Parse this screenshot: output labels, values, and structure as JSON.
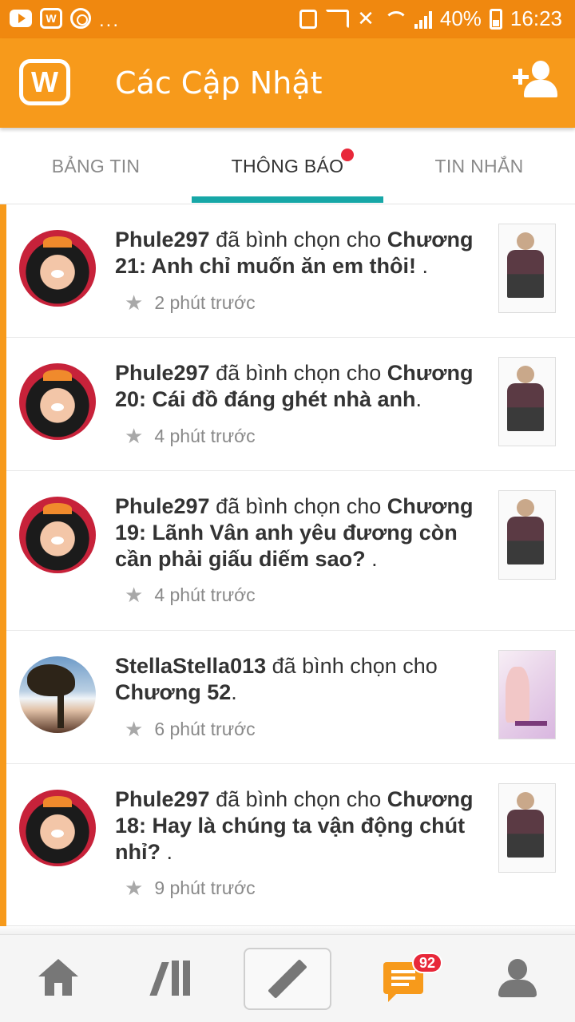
{
  "status_bar": {
    "ellipsis": "...",
    "battery": "40%",
    "time": "16:23",
    "icons": [
      "youtube-icon",
      "wattpad-icon",
      "sync-icon",
      "battery-saver-icon",
      "cast-icon",
      "mute-icon",
      "wifi-icon",
      "signal-icon",
      "battery-icon"
    ]
  },
  "app_bar": {
    "logo_letter": "W",
    "title": "Các Cập Nhật",
    "action_icon": "add-user-icon",
    "color": "#f79a1b"
  },
  "tabs": [
    {
      "label": "BẢNG TIN",
      "active": false
    },
    {
      "label": "THÔNG BÁO",
      "active": true,
      "has_dot": true
    },
    {
      "label": "TIN NHẮN",
      "active": false
    }
  ],
  "notifications": [
    {
      "user": "Phule297",
      "action": " đã bình chọn cho ",
      "target": "Chương 21: Anh chỉ muốn ăn em thôi!",
      "suffix": " .",
      "time": "2 phút trước",
      "avatar": "girl",
      "cover": "a"
    },
    {
      "user": "Phule297",
      "action": " đã bình chọn cho ",
      "target": "Chương 20: Cái đồ đáng ghét nhà anh",
      "suffix": ".",
      "time": "4 phút trước",
      "avatar": "girl",
      "cover": "a"
    },
    {
      "user": "Phule297",
      "action": " đã bình chọn cho ",
      "target": "Chương 19: Lãnh Vân anh yêu đương còn cần phải giấu diếm sao?",
      "suffix": " .",
      "time": "4 phút trước",
      "avatar": "girl",
      "cover": "a"
    },
    {
      "user": "StellaStella013",
      "action": " đã bình chọn cho ",
      "target": "Chương 52",
      "suffix": ".",
      "time": "6 phút trước",
      "avatar": "tree",
      "cover": "b"
    },
    {
      "user": "Phule297",
      "action": " đã bình chọn cho ",
      "target": "Chương 18: Hay là chúng ta vận động chút nhỉ?",
      "suffix": " .",
      "time": "9 phút trước",
      "avatar": "girl",
      "cover": "a"
    }
  ],
  "bottom_nav": {
    "items": [
      "home-icon",
      "library-icon",
      "write-icon",
      "messages-icon",
      "profile-icon"
    ],
    "messages_badge": "92"
  },
  "colors": {
    "accent": "#f79a1b",
    "status_bar": "#f0880f",
    "tab_indicator": "#17a7a7",
    "badge": "#e8283a"
  }
}
